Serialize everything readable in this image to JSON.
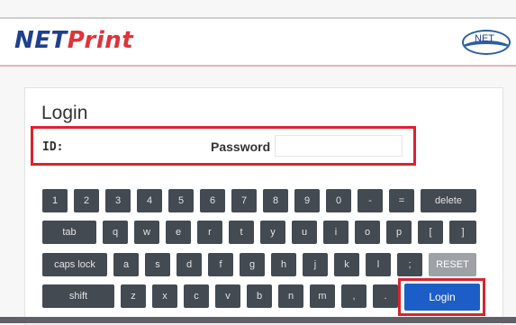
{
  "header": {
    "logo_part1": "NET",
    "logo_part2": "Print",
    "badge_text": "NET"
  },
  "login": {
    "title": "Login",
    "id_label": "ID:",
    "password_label": "Password"
  },
  "keyboard": {
    "row1": [
      "1",
      "2",
      "3",
      "4",
      "5",
      "6",
      "7",
      "8",
      "9",
      "0",
      "-",
      "=",
      "delete"
    ],
    "row2": [
      "tab",
      "q",
      "w",
      "e",
      "r",
      "t",
      "y",
      "u",
      "i",
      "o",
      "p",
      "[",
      "]"
    ],
    "row3": [
      "caps lock",
      "a",
      "s",
      "d",
      "f",
      "g",
      "h",
      "j",
      "k",
      "l",
      ";",
      "RESET"
    ],
    "row4": [
      "shift",
      "z",
      "x",
      "c",
      "v",
      "b",
      "n",
      "m",
      ",",
      ".",
      "Login"
    ]
  }
}
